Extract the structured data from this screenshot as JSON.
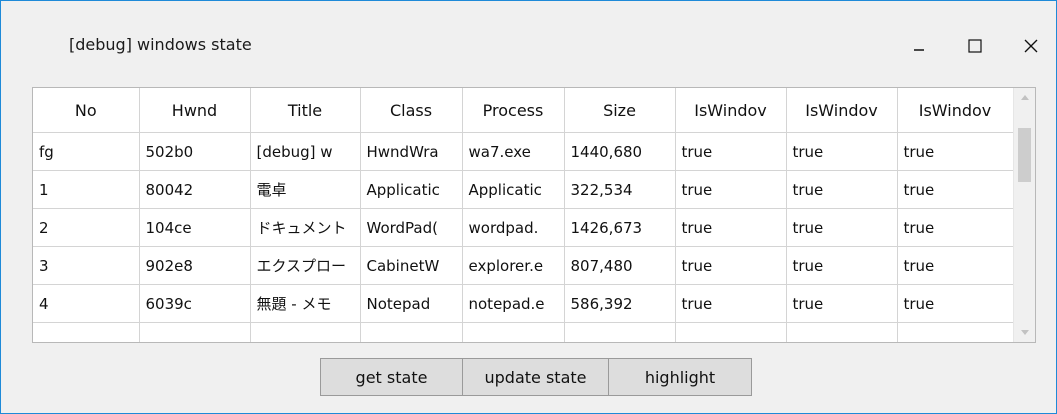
{
  "window": {
    "title": "[debug] windows state",
    "accent_color": "#1e8ad8"
  },
  "titlebar_buttons": {
    "minimize_icon": "minimize-icon",
    "maximize_icon": "maximize-icon",
    "close_icon": "close-icon"
  },
  "table": {
    "columns": [
      "No",
      "Hwnd",
      "Title",
      "Class",
      "Process",
      "Size",
      "IsWindov",
      "IsWindov",
      "IsWindov"
    ],
    "rows": [
      [
        "fg",
        "502b0",
        "[debug] w",
        "HwndWra",
        "wa7.exe",
        "1440,680",
        "true",
        "true",
        "true"
      ],
      [
        "1",
        "80042",
        "電卓",
        "Applicatic",
        "Applicatic",
        "322,534",
        "true",
        "true",
        "true"
      ],
      [
        "2",
        "104ce",
        "ドキュメント",
        "WordPad(",
        "wordpad.",
        "1426,673",
        "true",
        "true",
        "true"
      ],
      [
        "3",
        "902e8",
        "エクスプロー",
        "CabinetW",
        "explorer.e",
        "807,480",
        "true",
        "true",
        "true"
      ],
      [
        "4",
        "6039c",
        "無題 - メモ",
        "Notepad",
        "notepad.e",
        "586,392",
        "true",
        "true",
        "true"
      ]
    ]
  },
  "scrollbar": {
    "up_icon": "scroll-up-arrow-icon",
    "down_icon": "scroll-down-arrow-icon"
  },
  "buttons": {
    "get_state": "get state",
    "update_state": "update state",
    "highlight": "highlight"
  }
}
